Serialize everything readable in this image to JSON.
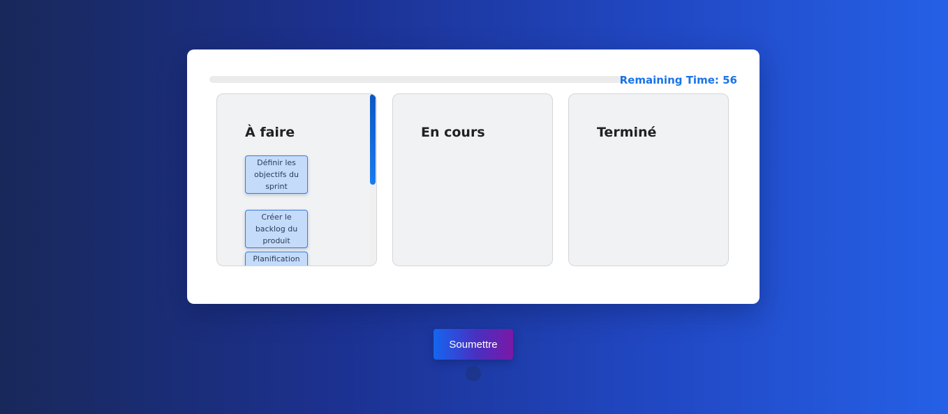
{
  "timer": {
    "label": "Remaining Time:",
    "value": "56",
    "elapsed_fraction": 0
  },
  "columns": [
    {
      "title": "À faire",
      "tasks": [
        "Définir les objectifs du sprint",
        "Créer le backlog du produit",
        "Planification du"
      ]
    },
    {
      "title": "En cours",
      "tasks": []
    },
    {
      "title": "Terminé",
      "tasks": []
    }
  ],
  "submit": {
    "label": "Soumettre"
  },
  "colors": {
    "accent": "#1a73e8",
    "task_bg": "#c4dcf9",
    "task_border": "#3a7be0"
  }
}
